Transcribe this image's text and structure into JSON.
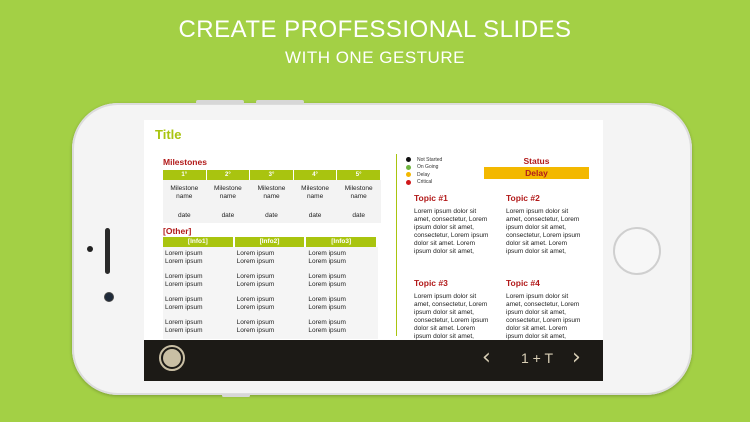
{
  "headline": {
    "line1": "CREATE PROFESSIONAL SLIDES",
    "line2": "WITH ONE GESTURE"
  },
  "slide": {
    "title": "Title",
    "milestones": {
      "heading": "Milestones",
      "columns": [
        "1°",
        "2°",
        "3°",
        "4°",
        "5°"
      ],
      "names": [
        "Milestone name",
        "Milestone name",
        "Milestone name",
        "Milestone name",
        "Milestone name"
      ],
      "dates": [
        "date",
        "date",
        "date",
        "date",
        "date"
      ]
    },
    "other": {
      "heading": "[Other]",
      "columns": [
        "[Info1]",
        "[Info2]",
        "[Info3]"
      ],
      "rows": [
        [
          "Lorem ipsum\nLorem ipsum",
          "Lorem ipsum\nLorem ipsum",
          "Lorem ipsum\nLorem ipsum"
        ],
        [
          "Lorem ipsum\nLorem ipsum",
          "Lorem ipsum\nLorem ipsum",
          "Lorem ipsum\nLorem ipsum"
        ],
        [
          "Lorem ipsum\nLorem ipsum",
          "Lorem ipsum\nLorem ipsum",
          "Lorem ipsum\nLorem ipsum"
        ],
        [
          "Lorem ipsum\nLorem ipsum",
          "Lorem ipsum\nLorem ipsum",
          "Lorem ipsum\nLorem ipsum"
        ]
      ]
    },
    "legend": [
      {
        "label": "Not Started",
        "color": "#111111"
      },
      {
        "label": "On Going",
        "color": "#6fb43f"
      },
      {
        "label": "Delay",
        "color": "#f3b800"
      },
      {
        "label": "Critical",
        "color": "#d0181a"
      }
    ],
    "status": {
      "label": "Status",
      "value": "Delay",
      "color": "#f3b800"
    },
    "topics": [
      {
        "title": "Topic #1",
        "body": "Lorem ipsum dolor sit amet, consectetur, Lorem ipsum dolor sit amet, consectetur, Lorem ipsum dolor sit amet. Lorem ipsum dolor sit amet,"
      },
      {
        "title": "Topic #2",
        "body": "Lorem ipsum dolor sit amet, consectetur, Lorem ipsum dolor sit amet, consectetur, Lorem ipsum dolor sit amet. Lorem ipsum dolor sit amet,"
      },
      {
        "title": "Topic #3",
        "body": "Lorem ipsum dolor sit amet, consectetur, Lorem ipsum dolor sit amet, consectetur, Lorem ipsum dolor sit amet. Lorem ipsum dolor sit amet,"
      },
      {
        "title": "Topic #4",
        "body": "Lorem ipsum dolor sit amet, consectetur, Lorem ipsum dolor sit amet, consectetur, Lorem ipsum dolor sit amet. Lorem ipsum dolor sit amet,"
      }
    ]
  },
  "toolbar": {
    "prev_icon": "chevron-left-icon",
    "next_icon": "chevron-right-icon",
    "prev_glyph": "‹",
    "next_glyph": "›",
    "page_indicator": "1 + T"
  },
  "colors": {
    "background": "#a3d045",
    "accent": "#a9c40f",
    "heading": "#b21a1a",
    "bar": "#1c1a16"
  }
}
